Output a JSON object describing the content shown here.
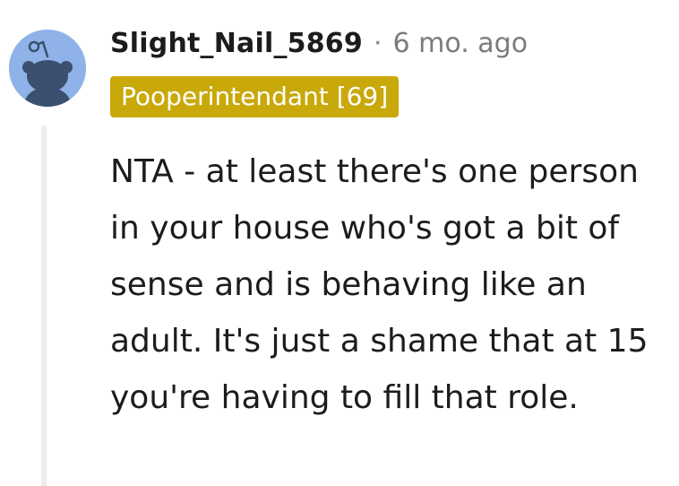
{
  "comment": {
    "username": "Slight_Nail_5869",
    "separator": "·",
    "timestamp": "6 mo. ago",
    "flair": "Pooperintendant [69]",
    "body": "NTA - at least there's one person in your house who's got a bit of sense and is behaving like an adult. It's just a shame that at 15 you're having to fill that role.",
    "avatar_icon": "snoo-avatar-icon"
  },
  "colors": {
    "flair_background": "#c9a80a",
    "avatar_background": "#8fb3e8",
    "thread_line": "#ededed"
  }
}
